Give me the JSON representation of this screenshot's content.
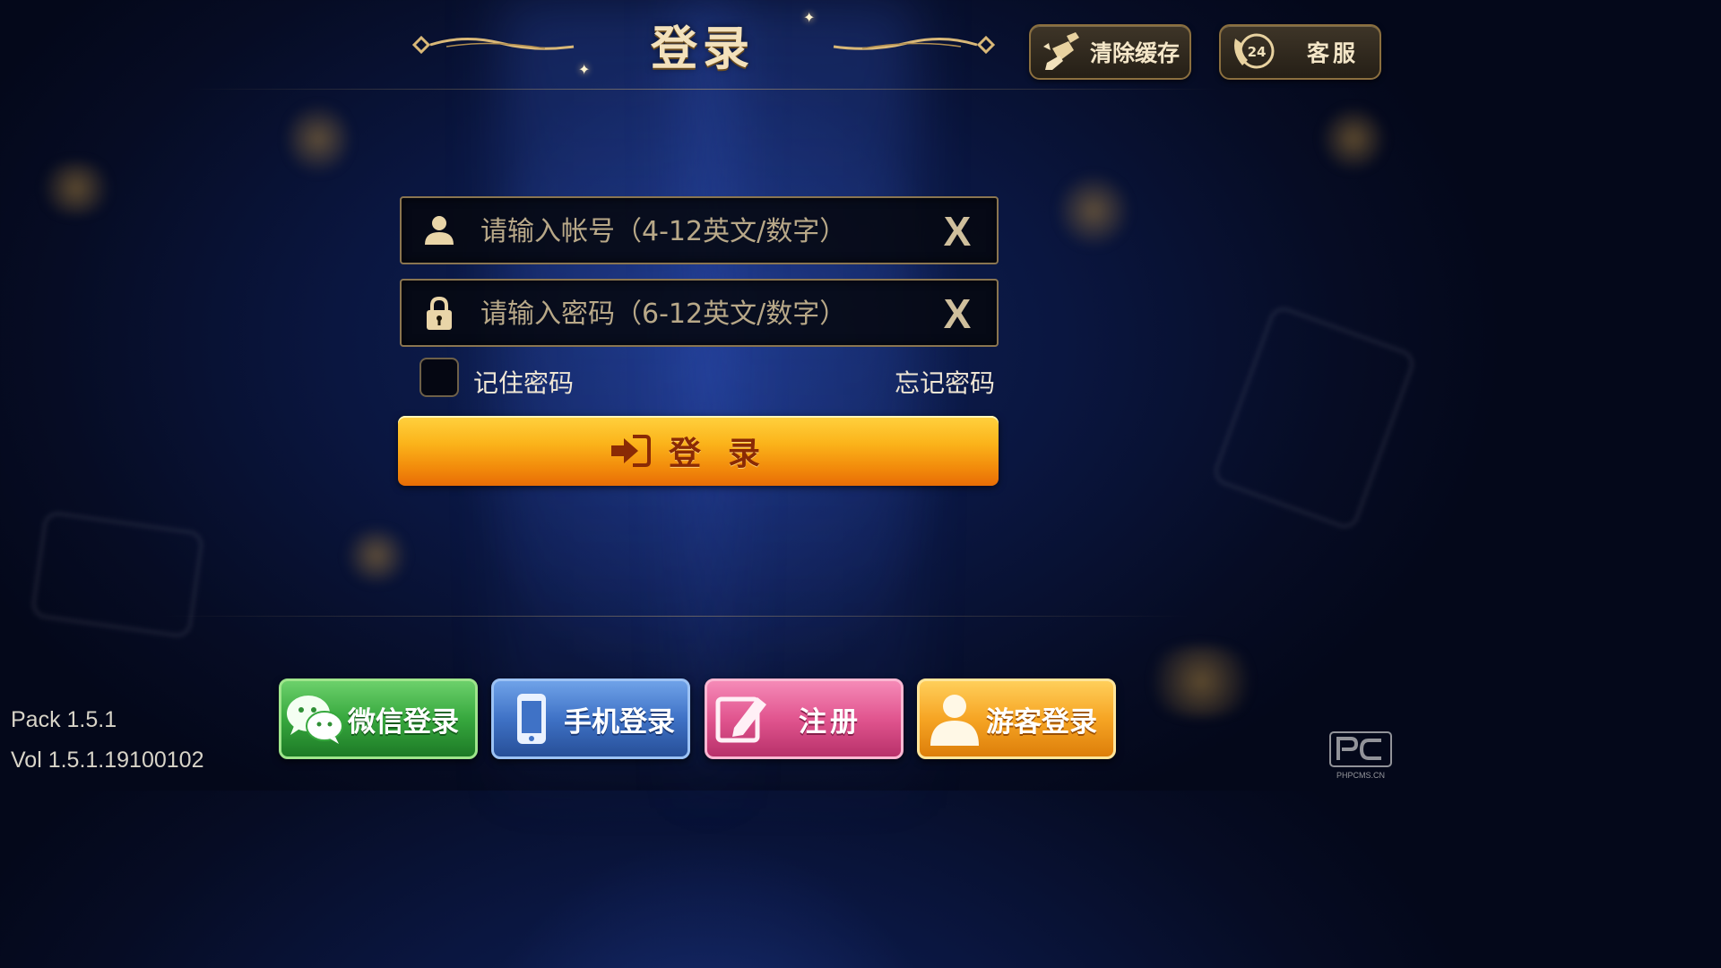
{
  "header": {
    "title": "登录",
    "clear_cache_label": "清除缓存",
    "service_label": "客服",
    "service_badge": "24"
  },
  "form": {
    "account_placeholder": "请输入帐号（4-12英文/数字）",
    "password_placeholder": "请输入密码（6-12英文/数字）",
    "clear_glyph": "X",
    "remember_label": "记住密码",
    "remember_checked": false,
    "forgot_label": "忘记密码",
    "login_label": "登录"
  },
  "alt_login": {
    "wechat": "微信登录",
    "phone": "手机登录",
    "register": "注册",
    "guest": "游客登录"
  },
  "version": {
    "pack": "Pack 1.5.1",
    "vol": "Vol 1.5.1.19100102"
  },
  "watermark": "PHPCMS.CN",
  "colors": {
    "accent_gold": "#f3e1bb",
    "login_orange": "#fbb31a",
    "wechat_green": "#37a83e",
    "phone_blue": "#3f72c6",
    "register_pink": "#e1558f",
    "guest_orange": "#f6a524"
  }
}
